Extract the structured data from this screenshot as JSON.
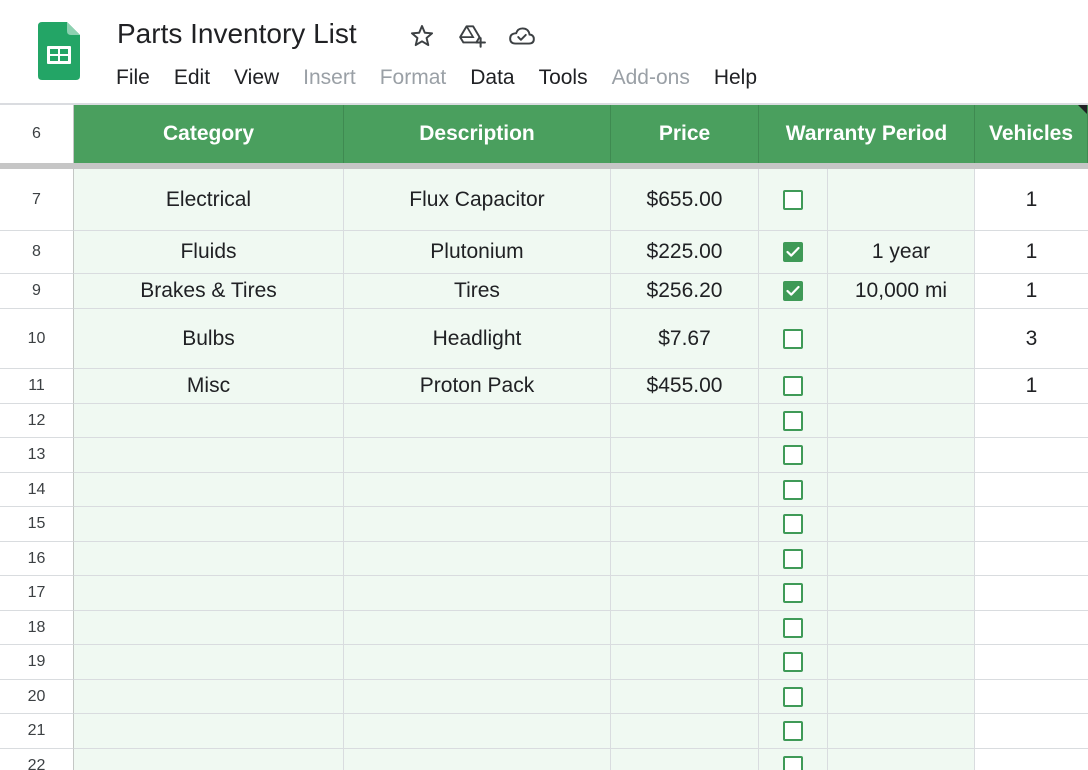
{
  "app": {
    "title": "Parts Inventory List",
    "icons": [
      "sheets-logo-icon",
      "star-icon",
      "move-to-drive-icon",
      "cloud-saved-icon"
    ]
  },
  "menu": [
    {
      "label": "File",
      "enabled": true
    },
    {
      "label": "Edit",
      "enabled": true
    },
    {
      "label": "View",
      "enabled": true
    },
    {
      "label": "Insert",
      "enabled": false
    },
    {
      "label": "Format",
      "enabled": false
    },
    {
      "label": "Data",
      "enabled": true
    },
    {
      "label": "Tools",
      "enabled": true
    },
    {
      "label": "Add-ons",
      "enabled": false
    },
    {
      "label": "Help",
      "enabled": true
    }
  ],
  "colors": {
    "header_green": "#4a9f5e",
    "row_tint": "#f0f9f2",
    "checkbox_green": "#3f9a57"
  },
  "header": {
    "row_number": "6",
    "category": "Category",
    "description": "Description",
    "price": "Price",
    "warranty": "Warranty Period",
    "vehicles": "Vehicles"
  },
  "rows": [
    {
      "num": "7",
      "category": "Electrical",
      "description": "Flux Capacitor",
      "price": "$655.00",
      "checked": false,
      "warranty": "",
      "vehicles": "1"
    },
    {
      "num": "8",
      "category": "Fluids",
      "description": "Plutonium",
      "price": "$225.00",
      "checked": true,
      "warranty": "1 year",
      "vehicles": "1"
    },
    {
      "num": "9",
      "category": "Brakes & Tires",
      "description": "Tires",
      "price": "$256.20",
      "checked": true,
      "warranty": "10,000 mi",
      "vehicles": "1"
    },
    {
      "num": "10",
      "category": "Bulbs",
      "description": "Headlight",
      "price": "$7.67",
      "checked": false,
      "warranty": "",
      "vehicles": "3"
    },
    {
      "num": "11",
      "category": "Misc",
      "description": "Proton Pack",
      "price": "$455.00",
      "checked": false,
      "warranty": "",
      "vehicles": "1"
    },
    {
      "num": "12",
      "category": "",
      "description": "",
      "price": "",
      "checked": false,
      "warranty": "",
      "vehicles": ""
    },
    {
      "num": "13",
      "category": "",
      "description": "",
      "price": "",
      "checked": false,
      "warranty": "",
      "vehicles": ""
    },
    {
      "num": "14",
      "category": "",
      "description": "",
      "price": "",
      "checked": false,
      "warranty": "",
      "vehicles": ""
    },
    {
      "num": "15",
      "category": "",
      "description": "",
      "price": "",
      "checked": false,
      "warranty": "",
      "vehicles": ""
    },
    {
      "num": "16",
      "category": "",
      "description": "",
      "price": "",
      "checked": false,
      "warranty": "",
      "vehicles": ""
    },
    {
      "num": "17",
      "category": "",
      "description": "",
      "price": "",
      "checked": false,
      "warranty": "",
      "vehicles": ""
    },
    {
      "num": "18",
      "category": "",
      "description": "",
      "price": "",
      "checked": false,
      "warranty": "",
      "vehicles": ""
    },
    {
      "num": "19",
      "category": "",
      "description": "",
      "price": "",
      "checked": false,
      "warranty": "",
      "vehicles": ""
    },
    {
      "num": "20",
      "category": "",
      "description": "",
      "price": "",
      "checked": false,
      "warranty": "",
      "vehicles": ""
    },
    {
      "num": "21",
      "category": "",
      "description": "",
      "price": "",
      "checked": false,
      "warranty": "",
      "vehicles": ""
    },
    {
      "num": "22",
      "category": "",
      "description": "",
      "price": "",
      "checked": false,
      "warranty": "",
      "vehicles": ""
    }
  ]
}
